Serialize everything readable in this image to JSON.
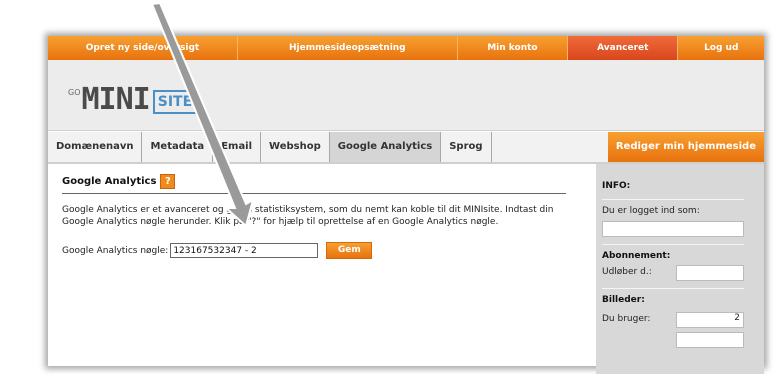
{
  "topnav": {
    "items": [
      "Opret ny side/oversigt",
      "Hjemmesideopsætning",
      "Min konto",
      "Avanceret",
      "Log ud"
    ]
  },
  "logo": {
    "prefix": "GO",
    "main": "MINI",
    "box": "SITE"
  },
  "tabs": [
    "Domænenavn",
    "Metadata",
    "Email",
    "Webshop",
    "Google Analytics",
    "Sprog"
  ],
  "edit_button": "Rediger min hjemmeside",
  "section": {
    "title": "Google Analytics",
    "help": "?",
    "desc": "Google Analytics er et avanceret og gratis statistiksystem, som du nemt kan koble til dit MINIsite. Indtast din Google Analytics nøgle herunder. Klik på \"?\" for hjælp til oprettelse af en Google Analytics nøgle.",
    "key_label": "Google Analytics nøgle:",
    "key_value": "123167532347 - 2",
    "save_label": "Gem"
  },
  "sidebar": {
    "info_title": "INFO:",
    "logged_in": "Du er logget ind som:",
    "subscription_title": "Abonnement:",
    "expires": "Udløber d.:",
    "images_title": "Billeder:",
    "uses": "Du bruger:",
    "uses_value": "2"
  },
  "colors": {
    "orange": "#e8720e",
    "red_active": "#d9471c",
    "sidebar_bg": "#d8d8d8"
  }
}
